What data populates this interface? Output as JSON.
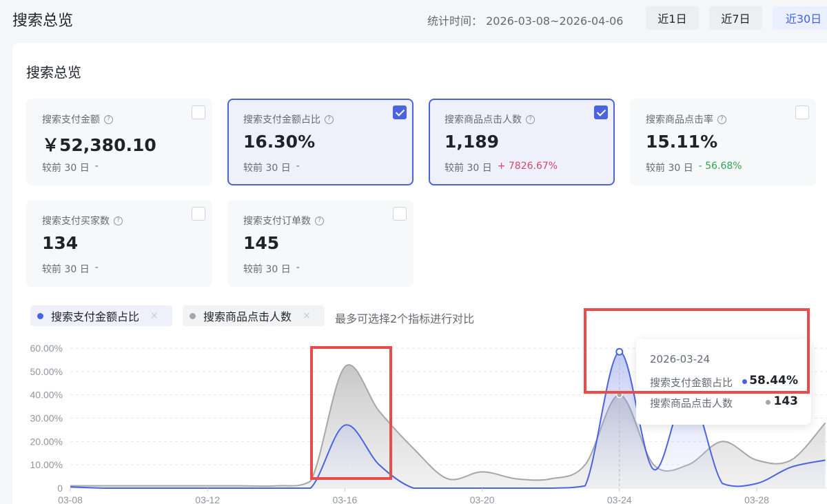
{
  "header": {
    "title": "搜索总览",
    "stat_time": "统计时间： 2026-03-08~2026-04-06",
    "ranges": [
      "近1日",
      "近7日",
      "近30日"
    ]
  },
  "overview": {
    "title": "搜索总览",
    "metrics": [
      {
        "label": "搜索支付金额",
        "value": "￥52,380.10",
        "compare": "较前 30 日",
        "delta": "-",
        "selected": false
      },
      {
        "label": "搜索支付金额占比",
        "value": "16.30%",
        "compare": "较前 30 日",
        "delta": "-",
        "selected": true
      },
      {
        "label": "搜索商品点击人数",
        "value": "1,189",
        "compare": "较前 30 日",
        "delta": "+ 7826.67%",
        "selected": true
      },
      {
        "label": "搜索商品点击率",
        "value": "15.11%",
        "compare": "较前 30 日",
        "delta": "- 56.68%",
        "selected": false
      },
      {
        "label": "搜索支付买家数",
        "value": "134",
        "compare": "较前 30 日",
        "delta": "-",
        "selected": false
      },
      {
        "label": "搜索支付订单数",
        "value": "145",
        "compare": "较前 30 日",
        "delta": "-",
        "selected": false
      }
    ]
  },
  "legend": {
    "tag1": "搜索支付金额占比",
    "tag2": "搜索商品点击人数",
    "close": "×",
    "hint": "最多可选择2个指标进行对比"
  },
  "colors": {
    "blue": "#4a64e0",
    "gray": "#a6a6a6",
    "highlight": "#ea4b4b"
  },
  "chart_data": {
    "type": "area",
    "y_ticks": [
      "60.00%",
      "50.00%",
      "40.00%",
      "30.00%",
      "20.00%",
      "10.00%",
      "0"
    ],
    "x_ticks": [
      "03-08",
      "03-12",
      "03-16",
      "03-20",
      "03-24",
      "03-28"
    ],
    "ylim": [
      0,
      60
    ],
    "grid": true,
    "series": [
      {
        "name": "搜索支付金额占比",
        "x": [
          "03-08",
          "03-09",
          "03-10",
          "03-11",
          "03-12",
          "03-13",
          "03-14",
          "03-15",
          "03-16",
          "03-17",
          "03-18",
          "03-19",
          "03-20",
          "03-21",
          "03-22",
          "03-23",
          "03-24",
          "03-25",
          "03-26",
          "03-27",
          "03-28",
          "03-29",
          "03-30"
        ],
        "values": [
          0.5,
          0,
          0,
          0,
          0,
          0,
          0,
          0,
          27,
          10,
          0,
          0,
          0,
          0,
          0,
          1,
          58.44,
          8,
          42,
          2,
          2,
          9,
          12
        ]
      },
      {
        "name": "搜索商品点击人数",
        "x": [
          "03-08",
          "03-09",
          "03-10",
          "03-11",
          "03-12",
          "03-13",
          "03-14",
          "03-15",
          "03-16",
          "03-17",
          "03-18",
          "03-19",
          "03-20",
          "03-21",
          "03-22",
          "03-23",
          "03-24",
          "03-25",
          "03-26",
          "03-27",
          "03-28",
          "03-29",
          "03-30"
        ],
        "values": [
          1,
          1,
          1,
          1,
          1,
          1,
          1,
          3,
          52,
          33,
          17,
          4,
          7,
          4,
          4,
          10,
          40,
          10,
          10,
          20,
          12,
          12,
          28
        ]
      }
    ]
  },
  "tooltip": {
    "date": "2026-03-24",
    "row1_label": "搜索支付金额占比",
    "row1_value": "58.44%",
    "row2_label": "搜索商品点击人数",
    "row2_value": "143"
  }
}
